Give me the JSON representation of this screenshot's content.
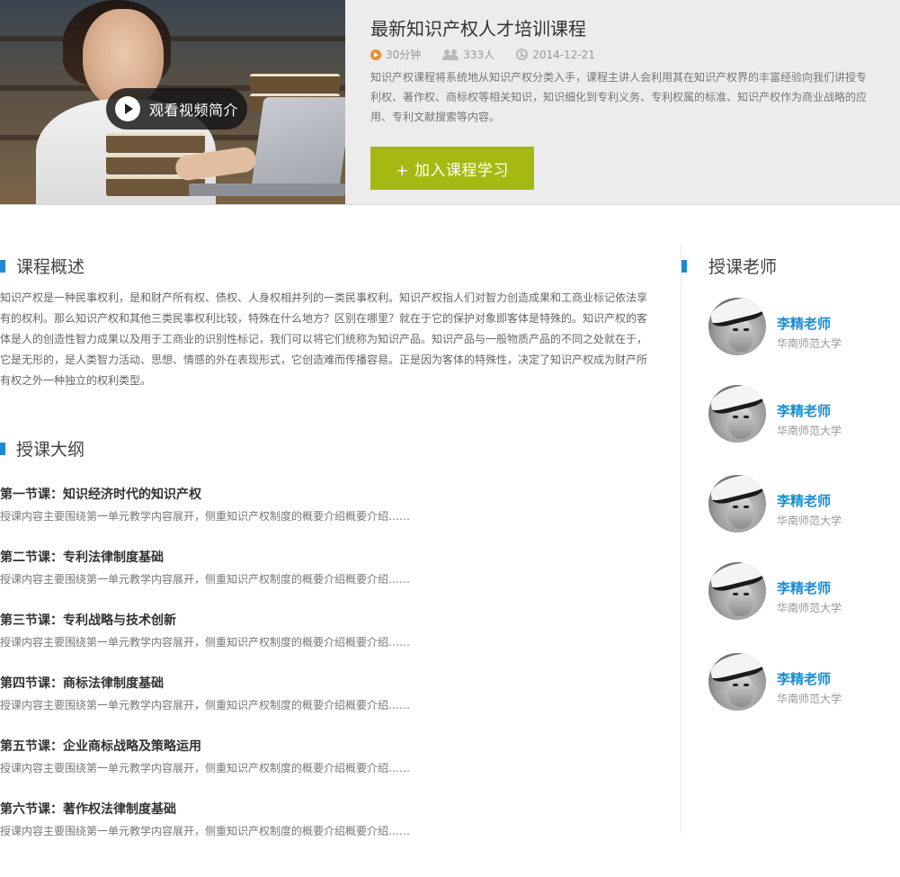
{
  "hero": {
    "video_button_label": "观看视频简介",
    "title": "最新知识产权人才培训课程",
    "meta": {
      "duration": "30分钟",
      "learners": "333人",
      "date": "2014-12-21"
    },
    "description": "知识产权课程将系统地从知识产权分类入手，课程主讲人会利用其在知识产权界的丰富经验向我们讲授专利权、著作权、商标权等相关知识，知识细化到专利义务、专利权属的标准、知识产权作为商业战略的应用、专利文献搜索等内容。",
    "join_button_label": "+ 加入课程学习",
    "colors": {
      "accent_green": "#a6b912",
      "duration_icon": "#f08c2c"
    },
    "icons": [
      "play-icon",
      "duration-icon",
      "users-icon",
      "clock-icon"
    ]
  },
  "overview": {
    "heading": "课程概述",
    "text": "知识产权是一种民事权利，是和财产所有权、债权、人身权相并列的一类民事权利。知识产权指人们对智力创造成果和工商业标记依法享有的权利。那么知识产权和其他三类民事权利比较，特殊在什么地方？区别在哪里？就在于它的保护对象即客体是特殊的。知识产权的客体是人的创造性智力成果以及用于工商业的识别性标记，我们可以将它们统称为知识产品。知识产品与一般物质产品的不同之处就在于，它是无形的，是人类智力活动、思想、情感的外在表现形式，它创造难而传播容易。正是因为客体的特殊性，决定了知识产权成为财产所有权之外一种独立的权利类型。"
  },
  "syllabus": {
    "heading": "授课大纲",
    "lessons": [
      {
        "title": "第一节课：知识经济时代的知识产权",
        "desc": "授课内容主要围绕第一单元教学内容展开，侧重知识产权制度的概要介绍概要介绍……"
      },
      {
        "title": "第二节课：专利法律制度基础",
        "desc": "授课内容主要围绕第一单元教学内容展开，侧重知识产权制度的概要介绍概要介绍……"
      },
      {
        "title": "第三节课：专利战略与技术创新",
        "desc": "授课内容主要围绕第一单元教学内容展开，侧重知识产权制度的概要介绍概要介绍……"
      },
      {
        "title": "第四节课：商标法律制度基础",
        "desc": "授课内容主要围绕第一单元教学内容展开，侧重知识产权制度的概要介绍概要介绍……"
      },
      {
        "title": "第五节课：企业商标战略及策略运用",
        "desc": "授课内容主要围绕第一单元教学内容展开，侧重知识产权制度的概要介绍概要介绍……"
      },
      {
        "title": "第六节课：著作权法律制度基础",
        "desc": "授课内容主要围绕第一单元教学内容展开，侧重知识产权制度的概要介绍概要介绍……"
      }
    ]
  },
  "teachers": {
    "heading": "授课老师",
    "list": [
      {
        "name": "李精老师",
        "school": "华南师范大学"
      },
      {
        "name": "李精老师",
        "school": "华南师范大学"
      },
      {
        "name": "李精老师",
        "school": "华南师范大学"
      },
      {
        "name": "李精老师",
        "school": "华南师范大学"
      },
      {
        "name": "李精老师",
        "school": "华南师范大学"
      }
    ],
    "colors": {
      "name": "#1a8fd2",
      "heading_marker": "#1f8ad3"
    }
  }
}
